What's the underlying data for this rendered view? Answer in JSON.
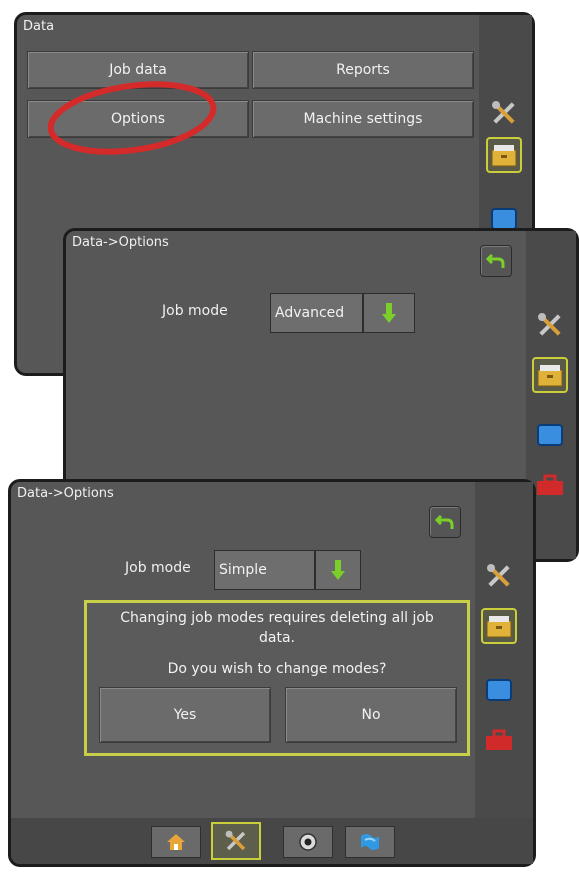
{
  "screen1": {
    "title": "Data",
    "buttons": {
      "job_data": "Job data",
      "reports": "Reports",
      "options": "Options",
      "machine_settings": "Machine settings"
    },
    "highlight_color": "#d52a2a"
  },
  "screen2": {
    "title": "Data->Options",
    "job_mode_label": "Job mode",
    "job_mode_value": "Advanced"
  },
  "screen3": {
    "title": "Data->Options",
    "job_mode_label": "Job mode",
    "job_mode_value": "Simple",
    "dialog": {
      "message_line1": "Changing job modes requires deleting all job",
      "message_line2": "data.",
      "question": "Do you wish to change modes?",
      "yes_label": "Yes",
      "no_label": "No",
      "border_color": "#c8d04a"
    }
  },
  "sidebar_icons": [
    "tools-icon",
    "data-folder-icon",
    "display-icon",
    "toolbox-icon"
  ],
  "bottom_tabs": [
    "home-icon",
    "tools-icon",
    "guidance-icon",
    "map-icon"
  ],
  "colors": {
    "accent_active": "#c9ce3a",
    "panel_bg": "#575757",
    "arrow_green": "#7ccf2a"
  }
}
